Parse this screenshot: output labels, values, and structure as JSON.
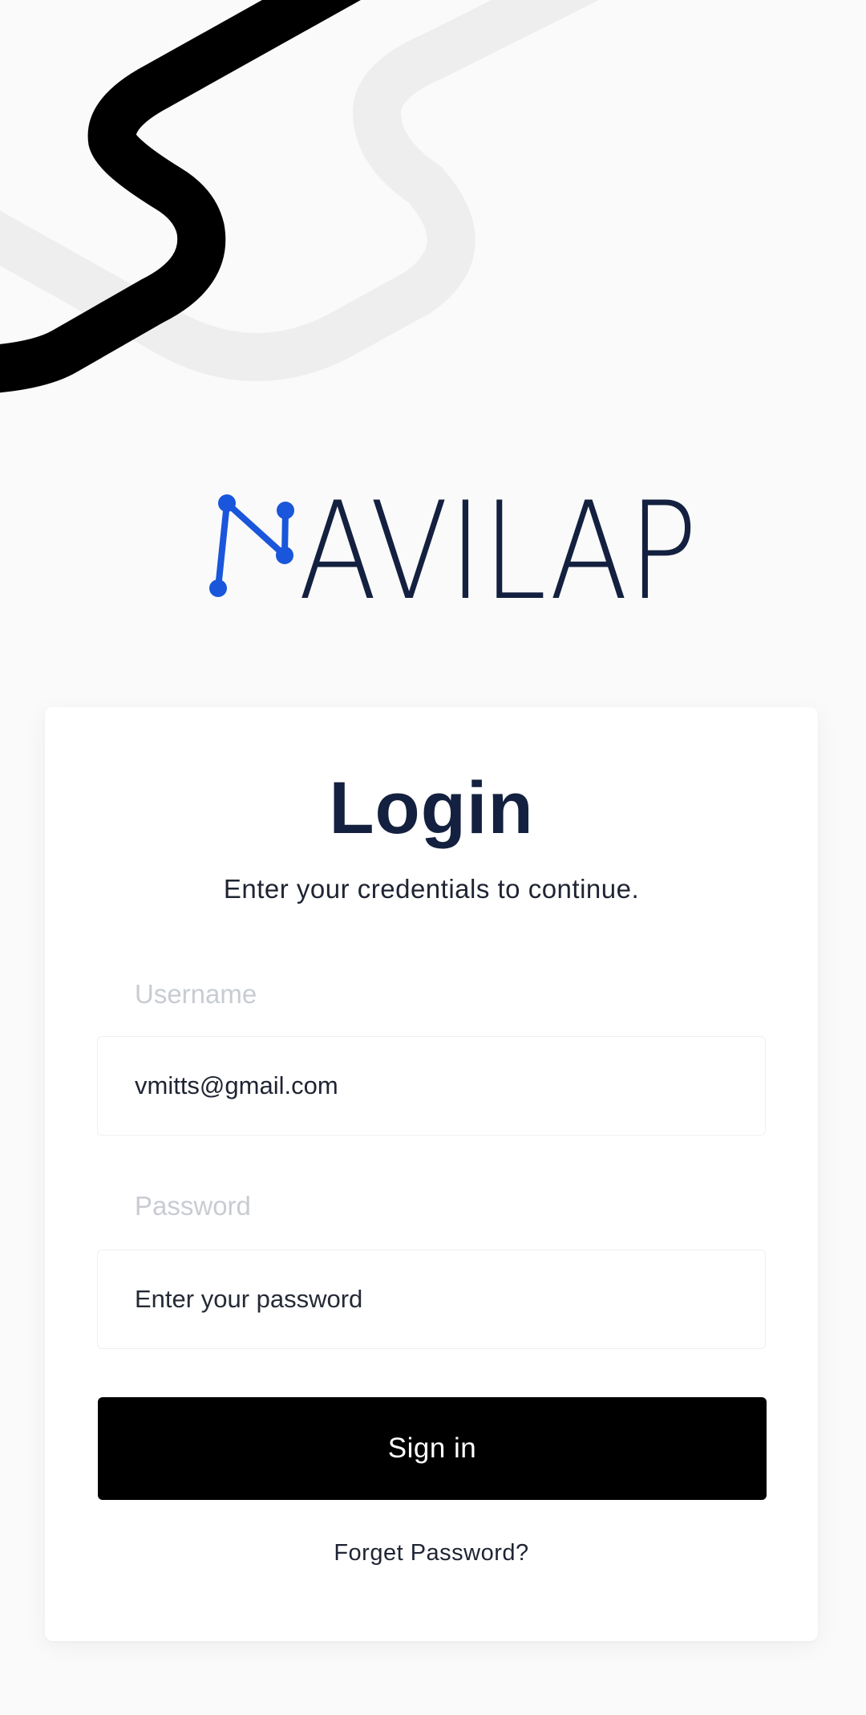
{
  "brand": {
    "name_rest": "AVILAP",
    "logo_color": "#1a56db",
    "text_color": "#14203f"
  },
  "login": {
    "title": "Login",
    "subtitle": "Enter your credentials to continue.",
    "username_label": "Username",
    "username_value": "vmitts@gmail.com",
    "password_label": "Password",
    "password_placeholder": "Enter your password",
    "signin_label": "Sign in",
    "forgot_label": "Forget Password?"
  },
  "colors": {
    "button_bg": "#000000",
    "label_muted": "#c8ccd2",
    "background": "#fafafa"
  }
}
